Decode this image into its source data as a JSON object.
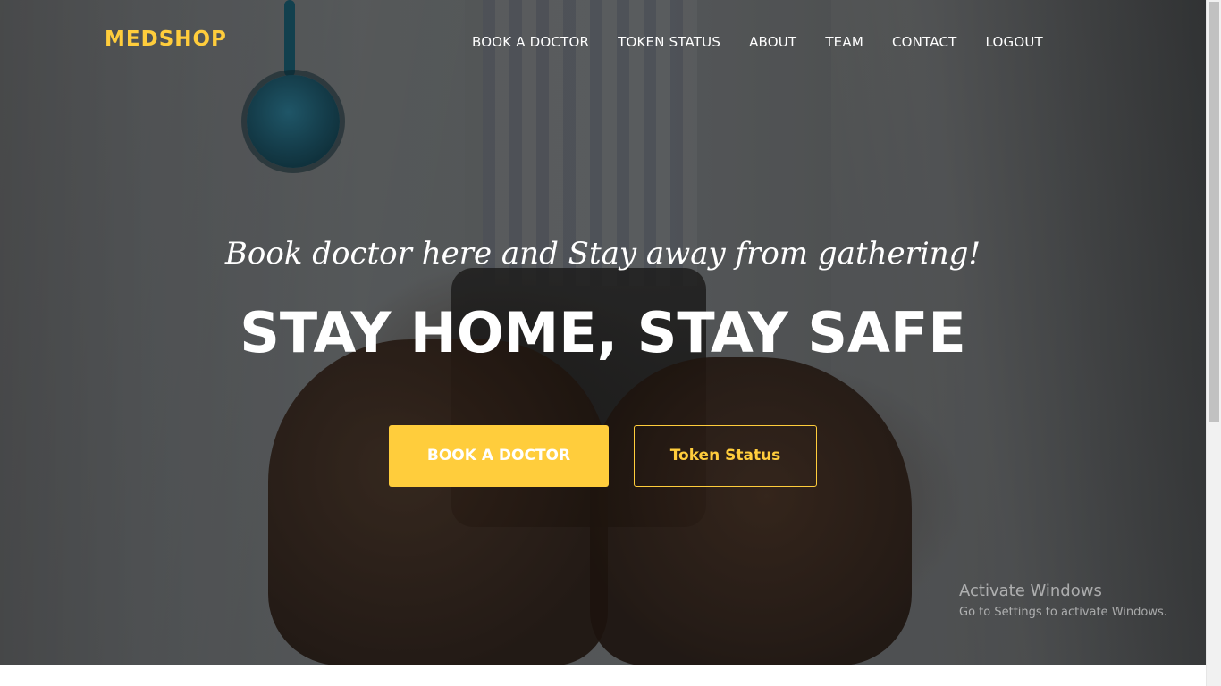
{
  "header": {
    "logo": "MEDSHOP",
    "nav": [
      {
        "label": "BOOK A DOCTOR"
      },
      {
        "label": "TOKEN STATUS"
      },
      {
        "label": "ABOUT"
      },
      {
        "label": "TEAM"
      },
      {
        "label": "CONTACT"
      },
      {
        "label": "LOGOUT"
      }
    ]
  },
  "hero": {
    "subtitle": "Book doctor here and Stay away from gathering!",
    "headline": "STAY HOME, STAY SAFE",
    "primary_button": "BOOK A DOCTOR",
    "secondary_button": "Token Status"
  },
  "watermark": {
    "title": "Activate Windows",
    "subtitle": "Go to Settings to activate Windows."
  },
  "colors": {
    "accent": "#ffcd3c",
    "text": "#ffffff"
  },
  "icons": {
    "background": "doctor-holding-phone-photo"
  }
}
